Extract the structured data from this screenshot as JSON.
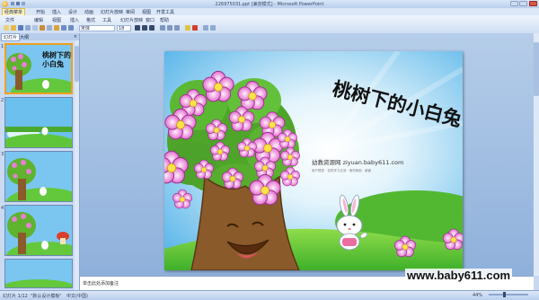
{
  "window": {
    "title": "226975031.ppt [兼容模式] - Microsoft PowerPoint"
  },
  "menu": {
    "items": [
      "经典菜单",
      "开始",
      "插入",
      "设计",
      "动画",
      "幻灯片放映",
      "审阅",
      "视图",
      "开发工具"
    ],
    "active_index": 0
  },
  "toolbar": {
    "row1": [
      "文件",
      "编辑",
      "视图",
      "插入",
      "格式",
      "工具",
      "幻灯片放映",
      "窗口",
      "帮助"
    ],
    "font": "宋体",
    "size": "18"
  },
  "left_panel": {
    "tabs": [
      "幻灯片",
      "大纲"
    ],
    "close": "×",
    "slides": [
      1,
      2,
      3,
      4
    ]
  },
  "slide": {
    "title": "桃树下的小白兔",
    "site_line": "幼教资源网 ziyuan.baby611.com",
    "site_small": "用户提供 · 仅供学习交流 · 请勿商用 · 谢谢"
  },
  "notes": {
    "placeholder": "单击此处添加备注"
  },
  "status": {
    "slide_counter": "幻灯片 1/12",
    "theme": "\"默认设计模板\"",
    "language": "中文(中国)",
    "zoom": "44%"
  },
  "watermark": "www.baby611.com",
  "colors": {
    "sky": "#5fb8ea",
    "grass": "#5cc93a",
    "trunk": "#8b5a2b",
    "blossom": "#e87fd6"
  }
}
